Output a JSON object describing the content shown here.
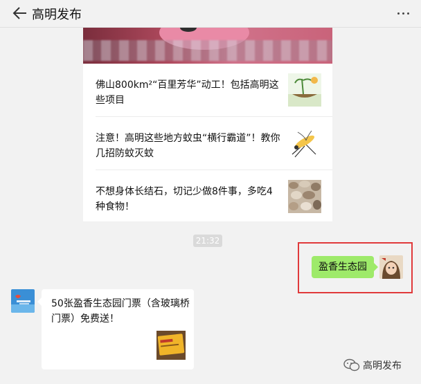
{
  "header": {
    "title": "高明发布",
    "back_icon": "back-arrow-icon",
    "more_icon": "more-dots-icon"
  },
  "news_card": {
    "items": [
      {
        "text": "佛山800km²“百里芳华”动工！包括高明这些项目",
        "thumb_icon": "landscape-thumbnail"
      },
      {
        "text": "注意！高明这些地方蚊虫“横行霸道”！教你几招防蚊灭蚊",
        "thumb_icon": "mosquito-thumbnail"
      },
      {
        "text": "不想身体长结石，切记少做8件事，多吃4种食物！",
        "thumb_icon": "stones-thumbnail"
      }
    ]
  },
  "chat": {
    "time": "21:32",
    "sent_message": "盈香生态园",
    "reply_message": "50张盈香生态园门票（含玻璃桥门票）免费送！"
  },
  "watermark": {
    "text": "高明发布"
  },
  "colors": {
    "background": "#f2f2f2",
    "sent_bubble": "#9eea6a",
    "highlight": "#e0393a",
    "time_badge": "#dadada"
  }
}
